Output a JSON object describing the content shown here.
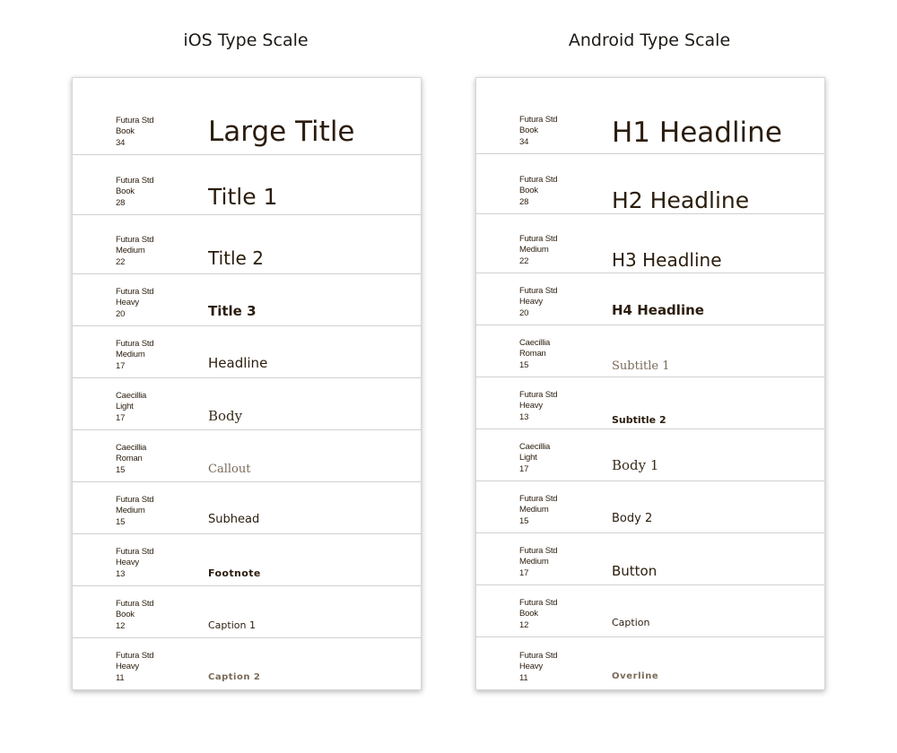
{
  "columns": [
    {
      "title": "iOS Type Scale",
      "rows": [
        {
          "family": "Futura Std",
          "weight": "Book",
          "size": "34",
          "label": "Large Title"
        },
        {
          "family": "Futura Std",
          "weight": "Book",
          "size": "28",
          "label": "Title 1"
        },
        {
          "family": "Futura Std",
          "weight": "Medium",
          "size": "22",
          "label": "Title 2"
        },
        {
          "family": "Futura Std",
          "weight": "Heavy",
          "size": "20",
          "label": "Title 3"
        },
        {
          "family": "Futura Std",
          "weight": "Medium",
          "size": "17",
          "label": "Headline"
        },
        {
          "family": "Caecillia",
          "weight": "Light",
          "size": "17",
          "label": "Body"
        },
        {
          "family": "Caecillia",
          "weight": "Roman",
          "size": "15",
          "label": "Callout"
        },
        {
          "family": "Futura Std",
          "weight": "Medium",
          "size": "15",
          "label": "Subhead"
        },
        {
          "family": "Futura Std",
          "weight": "Heavy",
          "size": "13",
          "label": "Footnote"
        },
        {
          "family": "Futura Std",
          "weight": "Book",
          "size": "12",
          "label": "Caption 1"
        },
        {
          "family": "Futura Std",
          "weight": "Heavy",
          "size": "11",
          "label": "Caption 2"
        }
      ]
    },
    {
      "title": "Android Type Scale",
      "rows": [
        {
          "family": "Futura Std",
          "weight": "Book",
          "size": "34",
          "label": "H1 Headline"
        },
        {
          "family": "Futura Std",
          "weight": "Book",
          "size": "28",
          "label": "H2 Headline"
        },
        {
          "family": "Futura Std",
          "weight": "Medium",
          "size": "22",
          "label": "H3 Headline"
        },
        {
          "family": "Futura Std",
          "weight": "Heavy",
          "size": "20",
          "label": "H4 Headline"
        },
        {
          "family": "Caecillia",
          "weight": "Roman",
          "size": "15",
          "label": "Subtitle 1"
        },
        {
          "family": "Futura Std",
          "weight": "Heavy",
          "size": "13",
          "label": "Subtitle 2"
        },
        {
          "family": "Caecillia",
          "weight": "Light",
          "size": "17",
          "label": "Body 1"
        },
        {
          "family": "Futura Std",
          "weight": "Medium",
          "size": "15",
          "label": "Body 2"
        },
        {
          "family": "Futura Std",
          "weight": "Medium",
          "size": "17",
          "label": "Button"
        },
        {
          "family": "Futura Std",
          "weight": "Book",
          "size": "12",
          "label": "Caption"
        },
        {
          "family": "Futura Std",
          "weight": "Heavy",
          "size": "11",
          "label": "Overline"
        }
      ]
    }
  ],
  "colors": {
    "text": "#2b1d0e",
    "muted": "#7a6a58",
    "divider": "#d0d0d0"
  }
}
